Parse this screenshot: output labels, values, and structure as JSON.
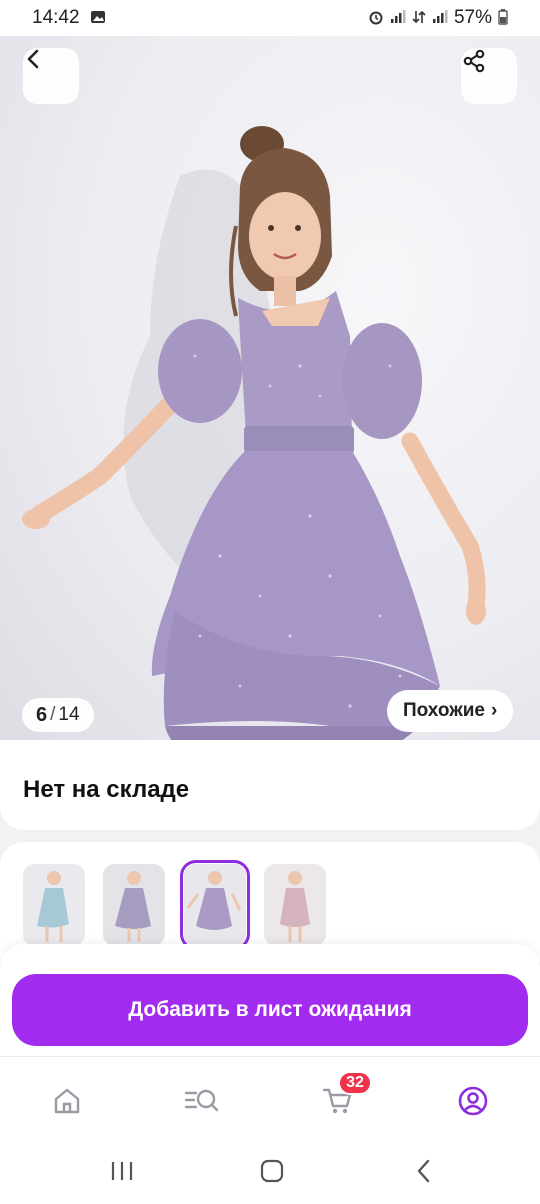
{
  "status_bar": {
    "time": "14:42",
    "battery": "57%",
    "icons": [
      "image-icon",
      "alarm-icon",
      "signal-icon",
      "data-icon",
      "signal-icon",
      "battery-icon"
    ]
  },
  "hero": {
    "counter_current": "6",
    "counter_sep": "/",
    "counter_total": "14",
    "similar_label": "Похожие",
    "similar_chevron": "›",
    "dress_color": "#a99bc6"
  },
  "stock": {
    "title": "Нет на складе"
  },
  "thumbnails": [
    {
      "name": "thumb-blue-dress",
      "color": "#a7c9d6",
      "selected": false
    },
    {
      "name": "thumb-lilac-dress-1",
      "color": "#a59cc0",
      "selected": false
    },
    {
      "name": "thumb-lilac-dress-2",
      "color": "#a99bc6",
      "selected": true
    },
    {
      "name": "thumb-pink-dress",
      "color": "#d4b3bd",
      "selected": false
    }
  ],
  "action": {
    "cta_label": "Добавить в лист ожидания",
    "accent": "#a12cf0"
  },
  "tab_bar": {
    "items": [
      "home-icon",
      "catalog-search-icon",
      "cart-icon",
      "profile-icon"
    ],
    "cart_badge": "32",
    "active_color": "#8f2dde"
  }
}
